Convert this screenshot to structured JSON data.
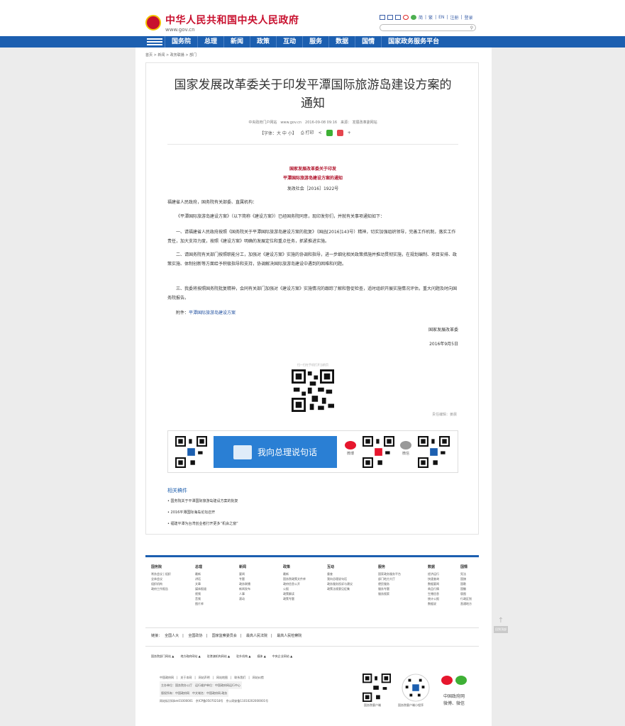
{
  "header": {
    "site_title": "中华人民共和国中央人民政府",
    "site_url": "www.gov.cn",
    "top_links": [
      "简",
      "繁",
      "EN",
      "注册",
      "登录"
    ]
  },
  "nav": {
    "items": [
      "国务院",
      "总理",
      "新闻",
      "政策",
      "互动",
      "服务",
      "数据",
      "国情",
      "国家政务服务平台"
    ]
  },
  "breadcrumb": [
    "首页",
    "新闻",
    "政务联播",
    "部门"
  ],
  "article": {
    "title_line1": "国家发展改革委关于印发平潭国际旅游岛建设方案的",
    "title_line2": "通知",
    "meta": "中央政府门户网站　www.gov.cn　2016-09-08 09:16　来源： 发展改革委网站",
    "font_label": "【字体：大 中 小】",
    "print_label": "打印",
    "doc_name_1": "国家发展改革委关于印发",
    "doc_name_2": "平潭国际旅游岛建设方案的通知",
    "doc_no": "发改社会［2016］1922号",
    "addressee": "福建省人民政府，国务院有关部委、直属机构：",
    "p1": "《平潭国际旅游岛建设方案》（以下简称《建设方案》）已经国务院同意，现印发你们，并就有关事项通知如下：",
    "p2": "一、请福建省人民政府按照《国务院关于平潭国际旅游岛建设方案的批复》（国函[2016]143号）精神，切实加强组织领导，完善工作机制，落实工作责任，加大支持力度，按照《建设方案》明确的发展定位和重点任务，抓紧推进实施。",
    "p3": "二、请国务院有关部门按照职能分工，加强对《建设方案》实施的协调和指导，进一步细化相关政策措施并推动贯彻实施，在规划编制、项目安排、政策实施、体制创新等方面给予积极指导和支持，协调解决国际旅游岛建设中遇到的困难和问题。",
    "p4": "三、我委将按照国务院批复精神，会同有关部门加强对《建设方案》实施情况的跟踪了解和督促检查，适时组织开展实施情况评估，重大问题及时向国务院报告。",
    "attachment_label": "附件：",
    "attachment_link": "平潭国际旅游岛建设方案",
    "signer": "国家发展改革委",
    "date": "2016年9月5日",
    "qr_caption": "扫一扫在手机打开当前页",
    "editor": "责任编辑：姜晨"
  },
  "banner": {
    "text": "我向总理说句话",
    "weibo": "微博",
    "weixin": "微信"
  },
  "related": {
    "title": "相关稿件",
    "items": [
      "国务院关于平潭国际旅游岛建设方案的批复",
      "2016平潭国际海岛论坛召开",
      "福建平潭为台湾创业者打开更多“机会之窗”"
    ]
  },
  "footer": {
    "columns": [
      {
        "title": "国务院",
        "items": [
          "常务会议 | 组织",
          "全体会议",
          "组织机构",
          "政府工作报告"
        ]
      },
      {
        "title": "总理",
        "items": [
          "最新",
          "讲话",
          "文章",
          "媒体报道",
          "视频",
          "音频",
          "图片库"
        ]
      },
      {
        "title": "新闻",
        "items": [
          "要闻",
          "专题",
          "政务联播",
          "新闻发布",
          "人事",
          "滚动"
        ]
      },
      {
        "title": "政策",
        "items": [
          "最新",
          "国务院政策文件库",
          "政府信息公开",
          "公报",
          "政策解读",
          "政策专题"
        ]
      },
      {
        "title": "互动",
        "items": [
          "督查",
          "我向总理说句话",
          "政务服务投诉与建议",
          "政策法规意见征集"
        ]
      },
      {
        "title": "服务",
        "items": [
          "国家政务服务平台",
          "部门地方大厅",
          "便民服务",
          "服务专题",
          "服务搜索"
        ]
      },
      {
        "title": "数据",
        "items": [
          "经济运行",
          "快速查询",
          "数据要闻",
          "商品行情",
          "生猪信息",
          "统计公报",
          "数据说"
        ]
      },
      {
        "title": "国情",
        "items": [
          "宪法",
          "国旗",
          "国歌",
          "国徽",
          "版图",
          "行政区划",
          "直通地方"
        ]
      }
    ],
    "links_label": "链接：",
    "links": [
      "全国人大",
      "全国政协",
      "国家监察委员会",
      "最高人民法院",
      "最高人民检察院"
    ],
    "nav_links": [
      "国务院部门网站",
      "地方政府网站",
      "驻港澳机构网站",
      "驻外机构",
      "媒体",
      "中央企业网站"
    ],
    "info_line1": "中国政府网　|　关于本网　|　网站声明　|　网站地图　|　联系我们　|　网站纠错",
    "info_line2": "主办单位：国务院办公厅　运行维护单位：中国政府网运行中心",
    "info_line3": "版权所有：中国政府网　中文域名：中国政府网.政务",
    "info_line4": "网站标识码bm01000001　京ICP备05070218号　京公网安备11010202000001号",
    "qr1_caption": "国务院客户端",
    "qr2_caption": "国务院客户端小程序",
    "social_caption_1": "中国政府网",
    "social_caption_2": "微博、微信",
    "back_to_top": "回到顶部"
  }
}
